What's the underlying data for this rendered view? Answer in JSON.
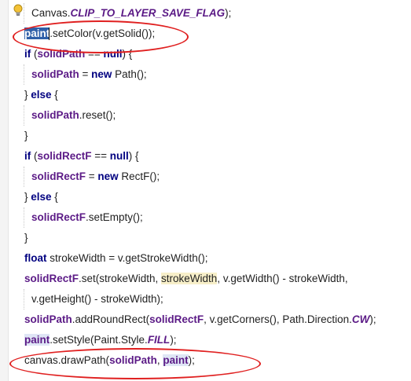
{
  "lines": [
    {
      "indent": 1,
      "tokens": [
        {
          "t": "Canvas.",
          "k": "plain"
        },
        {
          "t": "CLIP_TO_LAYER_SAVE_FLAG",
          "k": "static"
        },
        {
          "t": ");",
          "k": "plain"
        }
      ]
    },
    {
      "indent": 0,
      "tokens": [
        {
          "t": "paint",
          "k": "sel"
        },
        {
          "t": "",
          "k": "caret"
        },
        {
          "t": ".setColor(v.getSolid());",
          "k": "plain"
        }
      ]
    },
    {
      "indent": 0,
      "tokens": [
        {
          "t": "if",
          "k": "kw"
        },
        {
          "t": " (",
          "k": "plain"
        },
        {
          "t": "solidPath",
          "k": "field"
        },
        {
          "t": " == ",
          "k": "plain"
        },
        {
          "t": "null",
          "k": "kw"
        },
        {
          "t": ") {",
          "k": "plain"
        }
      ]
    },
    {
      "indent": 1,
      "tokens": [
        {
          "t": "solidPath",
          "k": "field"
        },
        {
          "t": " = ",
          "k": "plain"
        },
        {
          "t": "new",
          "k": "kw"
        },
        {
          "t": " Path();",
          "k": "plain"
        }
      ]
    },
    {
      "indent": 0,
      "tokens": [
        {
          "t": "} ",
          "k": "plain"
        },
        {
          "t": "else",
          "k": "kw"
        },
        {
          "t": " {",
          "k": "plain"
        }
      ]
    },
    {
      "indent": 1,
      "tokens": [
        {
          "t": "solidPath",
          "k": "field"
        },
        {
          "t": ".reset();",
          "k": "plain"
        }
      ]
    },
    {
      "indent": 0,
      "tokens": [
        {
          "t": "}",
          "k": "plain"
        }
      ]
    },
    {
      "indent": 0,
      "tokens": [
        {
          "t": "if",
          "k": "kw"
        },
        {
          "t": " (",
          "k": "plain"
        },
        {
          "t": "solidRectF",
          "k": "field"
        },
        {
          "t": " == ",
          "k": "plain"
        },
        {
          "t": "null",
          "k": "kw"
        },
        {
          "t": ") {",
          "k": "plain"
        }
      ]
    },
    {
      "indent": 1,
      "tokens": [
        {
          "t": "solidRectF",
          "k": "field"
        },
        {
          "t": " = ",
          "k": "plain"
        },
        {
          "t": "new",
          "k": "kw"
        },
        {
          "t": " RectF();",
          "k": "plain"
        }
      ]
    },
    {
      "indent": 0,
      "tokens": [
        {
          "t": "} ",
          "k": "plain"
        },
        {
          "t": "else",
          "k": "kw"
        },
        {
          "t": " {",
          "k": "plain"
        }
      ]
    },
    {
      "indent": 1,
      "tokens": [
        {
          "t": "solidRectF",
          "k": "field"
        },
        {
          "t": ".setEmpty();",
          "k": "plain"
        }
      ]
    },
    {
      "indent": 0,
      "tokens": [
        {
          "t": "}",
          "k": "plain"
        }
      ]
    },
    {
      "indent": 0,
      "tokens": [
        {
          "t": "float",
          "k": "kw"
        },
        {
          "t": " strokeWidth = v.getStrokeWidth();",
          "k": "plain"
        }
      ]
    },
    {
      "indent": 0,
      "tokens": [
        {
          "t": "solidRectF",
          "k": "field"
        },
        {
          "t": ".set(strokeWidth, ",
          "k": "plain"
        },
        {
          "t": "strokeWidth",
          "k": "hlwarm"
        },
        {
          "t": ", v.getWidth() - strokeWidth,",
          "k": "plain"
        }
      ]
    },
    {
      "indent": 1,
      "tokens": [
        {
          "t": "v.getHeight() - strokeWidth);",
          "k": "plain"
        }
      ]
    },
    {
      "indent": 0,
      "tokens": [
        {
          "t": "solidPath",
          "k": "field"
        },
        {
          "t": ".addRoundRect(",
          "k": "plain"
        },
        {
          "t": "solidRectF",
          "k": "field"
        },
        {
          "t": ", v.getCorners(), Path.Direction.",
          "k": "plain"
        },
        {
          "t": "CW",
          "k": "static"
        },
        {
          "t": ");",
          "k": "plain"
        }
      ]
    },
    {
      "indent": 0,
      "tokens": [
        {
          "t": "paint",
          "k": "field-hl"
        },
        {
          "t": ".setStyle(Paint.Style.",
          "k": "plain"
        },
        {
          "t": "FILL",
          "k": "static"
        },
        {
          "t": ");",
          "k": "plain"
        }
      ]
    },
    {
      "indent": 0,
      "tokens": [
        {
          "t": "canvas.drawPath(",
          "k": "plain"
        },
        {
          "t": "solidPath",
          "k": "field"
        },
        {
          "t": ", ",
          "k": "plain"
        },
        {
          "t": "paint",
          "k": "field-hl"
        },
        {
          "t": ");",
          "k": "plain"
        }
      ]
    }
  ],
  "icons": {
    "bulb": "lightbulb-icon"
  },
  "colors": {
    "field": "#5b1a86",
    "keyword": "#000080",
    "annotation": "#e02020",
    "selection": "#2f5fa8"
  }
}
